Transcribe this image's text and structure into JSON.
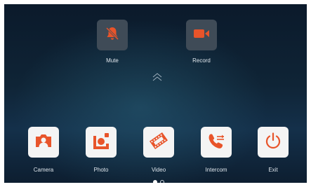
{
  "quick_actions": [
    {
      "label": "Mute",
      "icon": "bell-off-icon"
    },
    {
      "label": "Record",
      "icon": "video-camera-icon"
    }
  ],
  "expand_icon": "chevron-up-double-icon",
  "apps": [
    {
      "label": "Camera",
      "icon": "camera-icon"
    },
    {
      "label": "Photo",
      "icon": "photo-icon"
    },
    {
      "label": "Video",
      "icon": "film-icon"
    },
    {
      "label": "Intercom",
      "icon": "phone-transfer-icon"
    },
    {
      "label": "Exit",
      "icon": "power-icon"
    }
  ],
  "pager": {
    "pages": 2,
    "current": 1
  },
  "colors": {
    "accent": "#e8542a",
    "tile": "#f4f4f4",
    "quick_tile": "#3f4b57"
  }
}
